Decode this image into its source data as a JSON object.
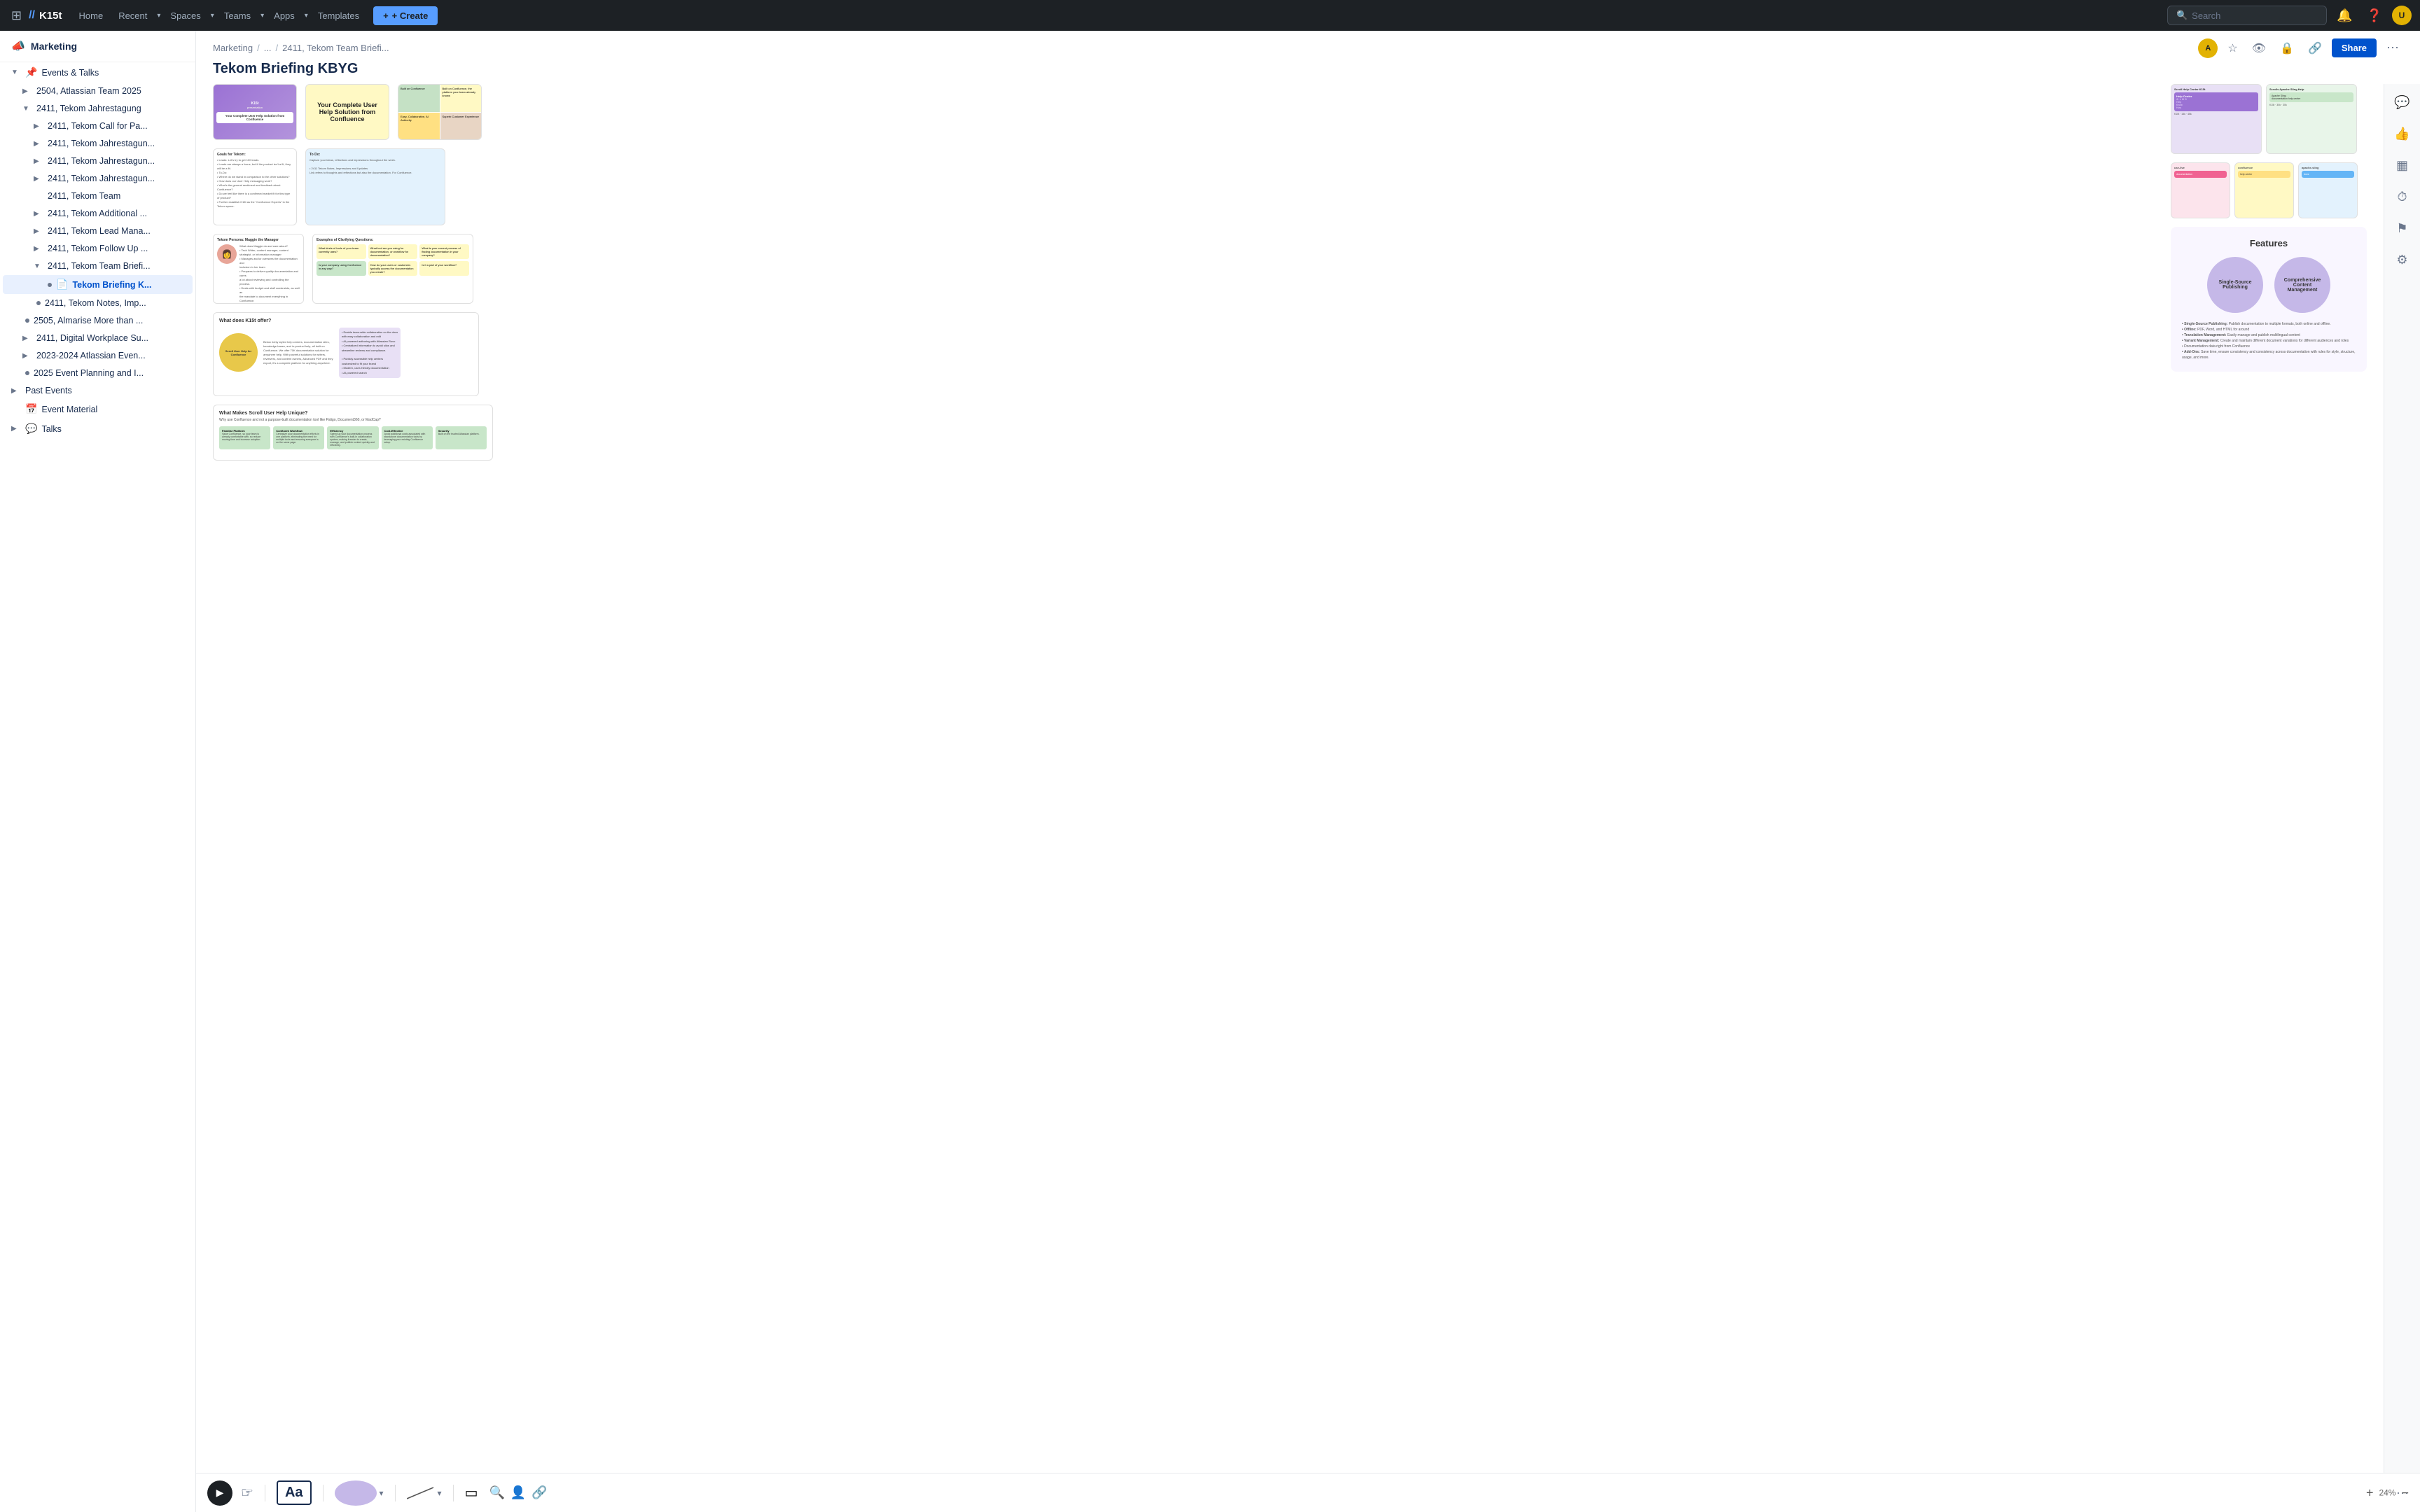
{
  "topnav": {
    "logo": "K15t",
    "logo_mark": "//",
    "links": [
      {
        "label": "Home",
        "id": "home"
      },
      {
        "label": "Recent",
        "id": "recent",
        "dropdown": true
      },
      {
        "label": "Spaces",
        "id": "spaces",
        "dropdown": true
      },
      {
        "label": "Teams",
        "id": "teams",
        "dropdown": true
      },
      {
        "label": "Apps",
        "id": "apps",
        "dropdown": true
      },
      {
        "label": "Templates",
        "id": "templates"
      }
    ],
    "create_label": "+ Create",
    "search_placeholder": "Search",
    "avatar_initials": "U"
  },
  "sidebar": {
    "space_name": "Marketing",
    "space_icon": "📣",
    "items": [
      {
        "id": "events-talks",
        "label": "Events & Talks",
        "icon": "📌",
        "indent": 0,
        "expanded": true,
        "has_chevron": true
      },
      {
        "id": "2504-atlassian",
        "label": "2504, Atlassian Team 2025",
        "indent": 1,
        "has_chevron": true
      },
      {
        "id": "2411-jahrestagung",
        "label": "2411, Tekom Jahrestagung",
        "indent": 1,
        "expanded": true,
        "has_chevron": true
      },
      {
        "id": "2411-call-for-pa",
        "label": "2411, Tekom Call for Pa...",
        "indent": 2,
        "has_chevron": true
      },
      {
        "id": "2411-jahrestagung-1",
        "label": "2411, Tekom Jahrestagun...",
        "indent": 2,
        "has_chevron": true
      },
      {
        "id": "2411-jahrestagung-2",
        "label": "2411, Tekom Jahrestagun...",
        "indent": 2,
        "has_chevron": true
      },
      {
        "id": "2411-jahrestagung-3",
        "label": "2411, Tekom Jahrestagun...",
        "indent": 2,
        "has_chevron": true
      },
      {
        "id": "2411-tekom-team",
        "label": "2411, Tekom Team",
        "indent": 2,
        "has_chevron": false
      },
      {
        "id": "2411-additional",
        "label": "2411, Tekom Additional ...",
        "indent": 2,
        "has_chevron": true
      },
      {
        "id": "2411-lead-mana",
        "label": "2411, Tekom Lead Mana...",
        "indent": 2,
        "has_chevron": true
      },
      {
        "id": "2411-follow-up",
        "label": "2411, Tekom Follow Up ...",
        "indent": 2,
        "has_chevron": true
      },
      {
        "id": "2411-team-briefi",
        "label": "2411, Tekom Team Briefi...",
        "indent": 2,
        "expanded": true,
        "has_chevron": true
      },
      {
        "id": "tekom-briefing-k",
        "label": "Tekom Briefing K...",
        "indent": 3,
        "active": true,
        "icon": "📄"
      },
      {
        "id": "2411-notes-imp",
        "label": "2411, Tekom Notes, Imp...",
        "indent": 2,
        "has_chevron": false
      },
      {
        "id": "2505-almarise",
        "label": "2505, Almarise More than ...",
        "indent": 1,
        "has_chevron": false
      },
      {
        "id": "2411-digital-wp",
        "label": "2411, Digital Workplace Su...",
        "indent": 1,
        "has_chevron": true
      },
      {
        "id": "2023-atlassian-even",
        "label": "2023-2024 Atlassian Even...",
        "indent": 1,
        "has_chevron": true
      },
      {
        "id": "2025-event-planning",
        "label": "2025 Event Planning and I...",
        "indent": 1,
        "has_chevron": false
      },
      {
        "id": "past-events",
        "label": "Past Events",
        "indent": 0,
        "has_chevron": true
      },
      {
        "id": "event-material",
        "label": "Event Material",
        "indent": 0,
        "icon": "📅",
        "has_chevron": false
      },
      {
        "id": "talks",
        "label": "Talks",
        "indent": 0,
        "icon": "💬",
        "has_chevron": true
      }
    ]
  },
  "breadcrumb": {
    "parts": [
      "Marketing",
      "...",
      "2411, Tekom Team Briefi..."
    ]
  },
  "page_title": "Tekom Briefing KBYG",
  "action_buttons": {
    "share_label": "Share"
  },
  "toolbar": {
    "play_icon": "▶",
    "cursor_icon": "☞",
    "text_label": "Aa",
    "more_label": "···",
    "zoom_percent": "24%"
  },
  "slides": {
    "title1": "Your Complete User Help Solution from Confluence",
    "features_title": "Features",
    "features_items": [
      "Single-Source Publishing",
      "Comprehensive Content Management"
    ],
    "efficiency_label": "Efficiency",
    "what_k15t_title": "What does K15t offer?",
    "what_scroll_label": "Scroll User Help for Confluence",
    "what_makes_unique": "What Makes Scroll User Help Unique?",
    "why_use_label": "Why use Confluence and not a purpose-built documentation tool like Paligo, Document360, or MadCap?"
  },
  "right_panel_icons": [
    {
      "id": "comments",
      "icon": "💬"
    },
    {
      "id": "thumbs-up",
      "icon": "👍"
    },
    {
      "id": "table",
      "icon": "▦"
    },
    {
      "id": "clock",
      "icon": "⏱"
    },
    {
      "id": "settings",
      "icon": "⚙"
    },
    {
      "id": "sliders",
      "icon": "≡"
    }
  ]
}
